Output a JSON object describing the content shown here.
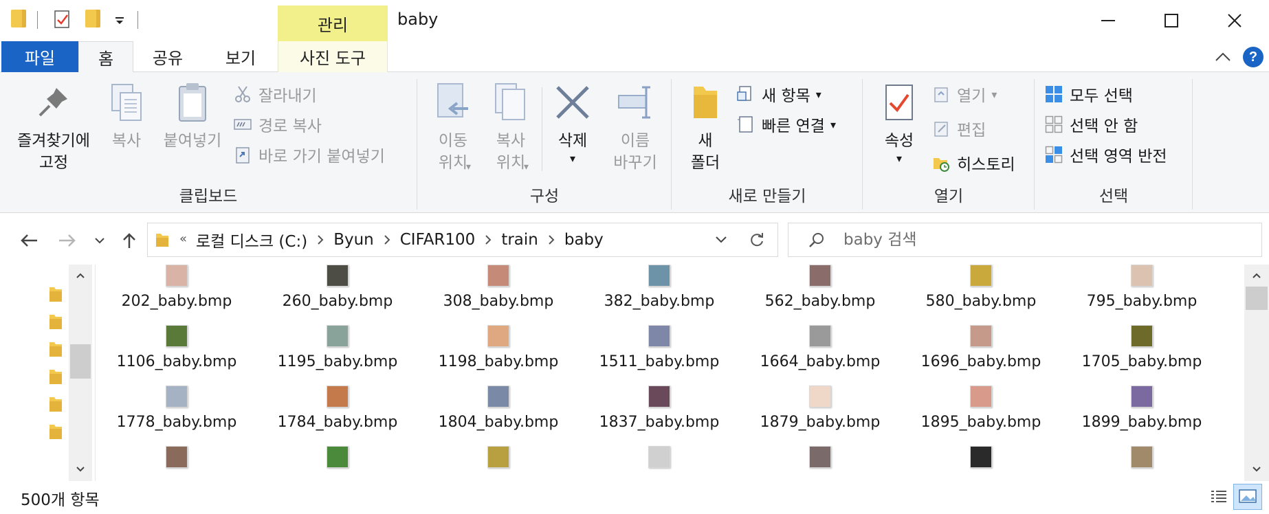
{
  "window": {
    "title": "baby",
    "contextual_tab_group": "관리",
    "accent_color": "#1a64c6",
    "contextual_color": "#f2f08a"
  },
  "quick_access": {
    "icons": [
      "folder-icon",
      "properties-icon",
      "new-folder-icon",
      "customize-dropdown-icon"
    ]
  },
  "window_controls": [
    "minimize-icon",
    "maximize-icon",
    "close-icon"
  ],
  "tabs": {
    "file": "파일",
    "home": "홈",
    "share": "공유",
    "view": "보기",
    "photo_tools": "사진 도구",
    "active": "홈"
  },
  "ribbon": {
    "clipboard": {
      "label": "클립보드",
      "pin": "즐겨찾기에\n고정",
      "copy": "복사",
      "paste": "붙여넣기",
      "cut": "잘라내기",
      "copy_path": "경로 복사",
      "paste_shortcut": "바로 가기 붙여넣기"
    },
    "organize": {
      "label": "구성",
      "move_to": "이동\n위치",
      "copy_to": "복사\n위치",
      "delete": "삭제",
      "rename": "이름\n바꾸기"
    },
    "new": {
      "label": "새로 만들기",
      "new_folder": "새\n폴더",
      "new_item": "새 항목",
      "easy_access": "빠른 연결"
    },
    "open": {
      "label": "열기",
      "properties": "속성",
      "open": "열기",
      "edit": "편집",
      "history": "히스토리"
    },
    "select": {
      "label": "선택",
      "select_all": "모두 선택",
      "select_none": "선택 안 함",
      "invert": "선택 영역 반전"
    }
  },
  "address": {
    "overflow": "«",
    "crumbs": [
      "로컬 디스크 (C:)",
      "Byun",
      "CIFAR100",
      "train",
      "baby"
    ]
  },
  "search": {
    "placeholder": "baby 검색"
  },
  "files": [
    {
      "name": "202_baby.bmp",
      "thumb": "#d9b3a6"
    },
    {
      "name": "260_baby.bmp",
      "thumb": "#4d4d45"
    },
    {
      "name": "308_baby.bmp",
      "thumb": "#c58a78"
    },
    {
      "name": "382_baby.bmp",
      "thumb": "#6c93a8"
    },
    {
      "name": "562_baby.bmp",
      "thumb": "#8a6c6a"
    },
    {
      "name": "580_baby.bmp",
      "thumb": "#c9a83c"
    },
    {
      "name": "795_baby.bmp",
      "thumb": "#dcc2b0"
    },
    {
      "name": "1106_baby.bmp",
      "thumb": "#5a7a3a"
    },
    {
      "name": "1195_baby.bmp",
      "thumb": "#8aa39a"
    },
    {
      "name": "1198_baby.bmp",
      "thumb": "#e0a880"
    },
    {
      "name": "1511_baby.bmp",
      "thumb": "#7f87a8"
    },
    {
      "name": "1664_baby.bmp",
      "thumb": "#9a9a9a"
    },
    {
      "name": "1696_baby.bmp",
      "thumb": "#c69a8a"
    },
    {
      "name": "1705_baby.bmp",
      "thumb": "#6e6a2a"
    },
    {
      "name": "1778_baby.bmp",
      "thumb": "#a5b2c4"
    },
    {
      "name": "1784_baby.bmp",
      "thumb": "#c47a4a"
    },
    {
      "name": "1804_baby.bmp",
      "thumb": "#7a8aa6"
    },
    {
      "name": "1837_baby.bmp",
      "thumb": "#6a4a5a"
    },
    {
      "name": "1879_baby.bmp",
      "thumb": "#efd8c8"
    },
    {
      "name": "1895_baby.bmp",
      "thumb": "#d89a8a"
    },
    {
      "name": "1899_baby.bmp",
      "thumb": "#7a6aa0"
    },
    {
      "name": "",
      "thumb": "#8a6a5a"
    },
    {
      "name": "",
      "thumb": "#4a8a3a"
    },
    {
      "name": "",
      "thumb": "#b8a040"
    },
    {
      "name": "",
      "thumb": "#d0d0d0"
    },
    {
      "name": "",
      "thumb": "#7a6a6a"
    },
    {
      "name": "",
      "thumb": "#2a2a2a"
    },
    {
      "name": "",
      "thumb": "#a08a6a"
    }
  ],
  "status": {
    "count": "500개 항목"
  }
}
